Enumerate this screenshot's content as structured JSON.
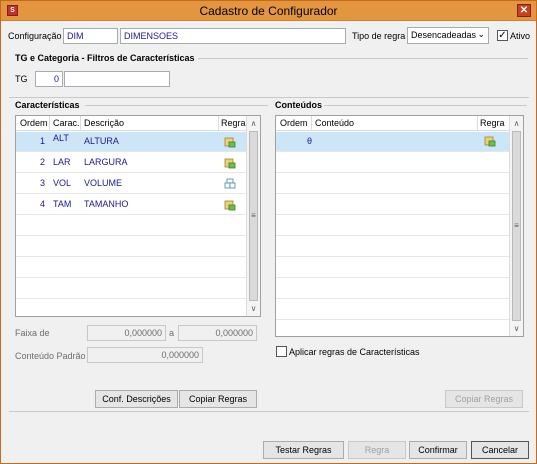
{
  "window": {
    "title": "Cadastro de Configurador",
    "close_label": "✕"
  },
  "header": {
    "config_label": "Configuração",
    "config_code": "DIM",
    "config_desc": "DIMENSOES",
    "rule_type_label": "Tipo de regra",
    "rule_type_value": "Desencadeadas",
    "ativo_label": "Ativo",
    "ativo_checked": true
  },
  "tg_section": {
    "title": "TG e Categoria - Filtros de Características",
    "tg_label": "TG",
    "tg_value": "0",
    "tg_desc": ""
  },
  "caracteristicas": {
    "title": "Características",
    "columns": [
      "Ordem",
      "Carac.",
      "Descrição",
      "Regra"
    ],
    "rows": [
      {
        "ordem": "1",
        "carac": "ALT",
        "descricao": "ALTURA",
        "regra_icon": "rule-lock-icon"
      },
      {
        "ordem": "2",
        "carac": "LAR",
        "descricao": "LARGURA",
        "regra_icon": "rule-lock-icon"
      },
      {
        "ordem": "3",
        "carac": "VOL",
        "descricao": "VOLUME",
        "regra_icon": "rule-puzzle-icon"
      },
      {
        "ordem": "4",
        "carac": "TAM",
        "descricao": "TAMANHO",
        "regra_icon": "rule-lock-icon"
      }
    ],
    "faixa_label": "Faixa de",
    "faixa_from": "0,000000",
    "faixa_a": "a",
    "faixa_to": "0,000000",
    "conteudo_padrao_label": "Conteúdo Padrão",
    "conteudo_padrao_value": "0,000000",
    "conf_descricoes_label": "Conf. Descrições",
    "copiar_regras_label": "Copiar Regras"
  },
  "conteudos": {
    "title": "Conteúdos",
    "columns": [
      "Ordem",
      "Conteúdo",
      "Regra"
    ],
    "rows": [
      {
        "ordem": "θ",
        "conteudo": "",
        "regra_icon": "rule-lock-icon"
      }
    ],
    "aplicar_label": "Aplicar regras de Características",
    "copiar_regras_label": "Copiar Regras"
  },
  "footer": {
    "testar_regras_label": "Testar Regras",
    "regra_label": "Regra",
    "confirmar_label": "Confirmar",
    "cancelar_label": "Cancelar"
  },
  "colors": {
    "title_bar": "#e39540",
    "selected_row": "#cde6f7",
    "value_text": "#1a1a8c"
  }
}
